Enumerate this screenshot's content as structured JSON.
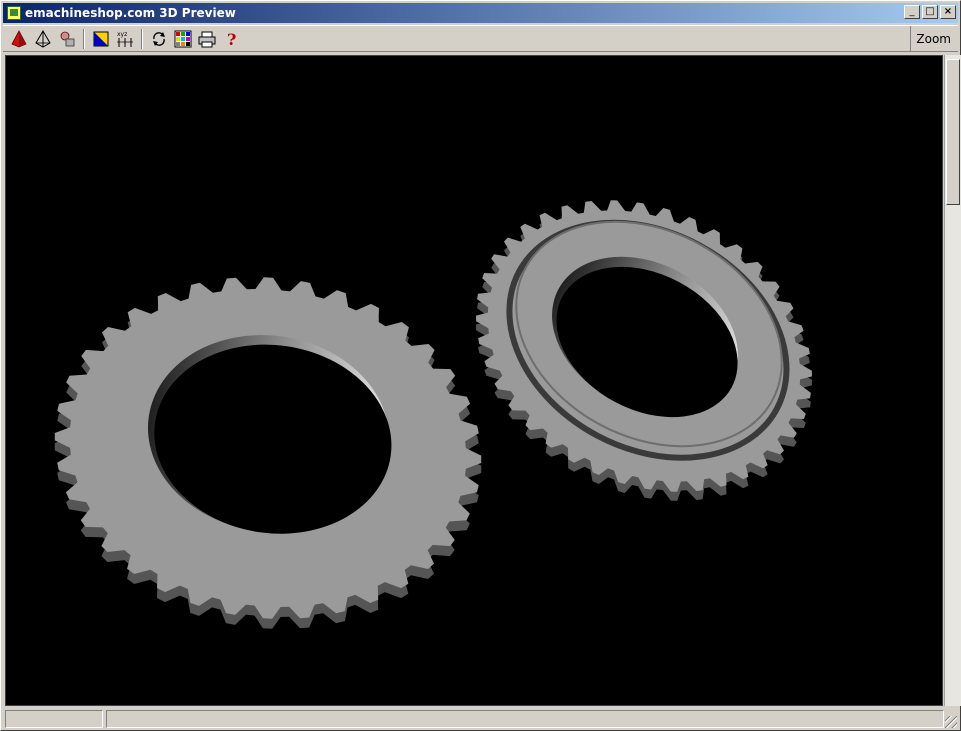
{
  "window": {
    "title": "emachineshop.com 3D Preview",
    "caption_buttons": {
      "minimize": "_",
      "maximize": "□",
      "close": "×"
    }
  },
  "toolbar": {
    "buttons": [
      {
        "name": "solid-view",
        "icon": "red-pyramid-icon"
      },
      {
        "name": "wireframe-view",
        "icon": "wire-pyramid-icon"
      },
      {
        "name": "shapes",
        "icon": "shapes-icon"
      },
      {
        "name": "color",
        "icon": "color-swatch-icon"
      },
      {
        "name": "axes",
        "icon": "xyz-axes-icon"
      },
      {
        "name": "rotate",
        "icon": "rotate-icon"
      },
      {
        "name": "palette",
        "icon": "palette-icon"
      },
      {
        "name": "print",
        "icon": "printer-icon"
      },
      {
        "name": "help",
        "icon": "help-icon"
      }
    ],
    "zoom_label": "Zoom"
  },
  "viewport": {
    "background": "#000000",
    "part_color": "#9a9a9a",
    "gears": [
      {
        "name": "large-gear",
        "teeth": 36
      },
      {
        "name": "small-gear",
        "teeth": 40
      }
    ]
  },
  "statusbar": {
    "pane1": "",
    "pane2": ""
  },
  "colors": {
    "title_active": "#0a246a",
    "title_fade": "#a6caf0",
    "chrome": "#d4d0c8"
  }
}
